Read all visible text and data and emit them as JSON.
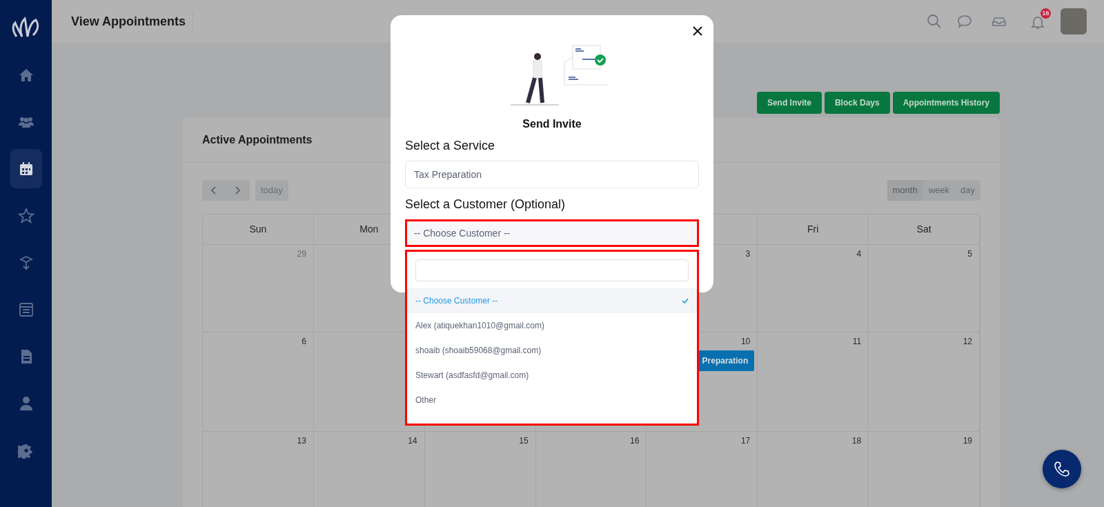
{
  "sidebar": {
    "items": [
      {
        "selected": false
      },
      {
        "selected": false
      },
      {
        "selected": true
      },
      {
        "selected": false
      },
      {
        "selected": false
      },
      {
        "selected": false
      },
      {
        "selected": false
      },
      {
        "selected": false
      },
      {
        "selected": false
      }
    ]
  },
  "header": {
    "title": "View Appointments",
    "notification_count": "16"
  },
  "actions": [
    "Send Invite",
    "Block Days",
    "Appointments History"
  ],
  "calendar": {
    "title": "Active Appointments",
    "today_button": "today",
    "views": [
      {
        "label": "month",
        "selected": true
      },
      {
        "label": "week",
        "selected": false
      },
      {
        "label": "day",
        "selected": false
      }
    ],
    "weekdays": {
      "left": [
        "Sun",
        "Mon"
      ],
      "right": [
        "Fri",
        "Sat"
      ]
    },
    "weeks": [
      {
        "left": [
          {
            "date": "29",
            "other_month": true
          }
        ],
        "right": [
          {
            "date": "3",
            "other_month": false
          },
          {
            "date": "4",
            "other_month": false
          },
          {
            "date": "5",
            "other_month": false
          }
        ]
      },
      {
        "left": [
          {
            "date": "6",
            "other_month": false
          }
        ],
        "right": [
          {
            "date": "10",
            "other_month": false,
            "event": "Preparation"
          },
          {
            "date": "11",
            "other_month": false
          },
          {
            "date": "12",
            "other_month": false
          }
        ]
      },
      {
        "left": [
          {
            "date": "13",
            "other_month": false
          },
          {
            "date": "14",
            "other_month": false
          },
          {
            "date": "15",
            "other_month": false
          },
          {
            "date": "16",
            "other_month": false
          },
          {
            "date": "17",
            "other_month": false
          },
          {
            "date": "18",
            "other_month": false
          },
          {
            "date": "19",
            "other_month": false
          }
        ]
      }
    ]
  },
  "modal": {
    "title": "Send Invite",
    "service_label": "Select a Service",
    "service_value": "Tax Preparation",
    "customer_label": "Select a Customer (Optional)",
    "customer_value": "-- Choose Customer --",
    "dropdown": {
      "expanded": true,
      "options": [
        {
          "label": "-- Choose Customer --",
          "selected": true
        },
        {
          "label": "Alex (atiquekhan1010@gmail.com)",
          "selected": false
        },
        {
          "label": "shoaib (shoaib59068@gmail.com)",
          "selected": false
        },
        {
          "label": "Stewart (asdfasfd@gmail.com)",
          "selected": false
        },
        {
          "label": "Other",
          "selected": false
        }
      ]
    }
  }
}
